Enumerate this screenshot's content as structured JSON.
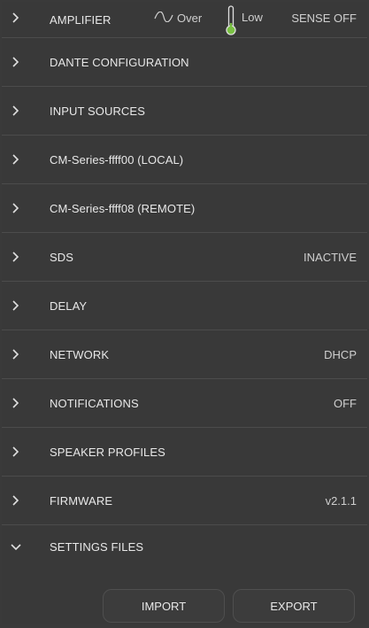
{
  "amplifier": {
    "label": "AMPLIFIER",
    "over_label": "Over",
    "temp_label": "Low",
    "sense_label": "SENSE OFF"
  },
  "rows": [
    {
      "label": "DANTE CONFIGURATION",
      "value": ""
    },
    {
      "label": "INPUT SOURCES",
      "value": ""
    },
    {
      "label": "CM-Series-ffff00 (LOCAL)",
      "value": ""
    },
    {
      "label": "CM-Series-ffff08 (REMOTE)",
      "value": ""
    },
    {
      "label": "SDS",
      "value": "INACTIVE"
    },
    {
      "label": "DELAY",
      "value": ""
    },
    {
      "label": "NETWORK",
      "value": "DHCP"
    },
    {
      "label": "NOTIFICATIONS",
      "value": "OFF"
    },
    {
      "label": "SPEAKER PROFILES",
      "value": ""
    },
    {
      "label": "FIRMWARE",
      "value": "v2.1.1"
    }
  ],
  "settings_files": {
    "label": "SETTINGS FILES",
    "import_label": "IMPORT",
    "export_label": "EXPORT"
  },
  "colors": {
    "background": "#393939",
    "divider": "#4c4c4c",
    "thermometer_green": "#7ac143"
  }
}
